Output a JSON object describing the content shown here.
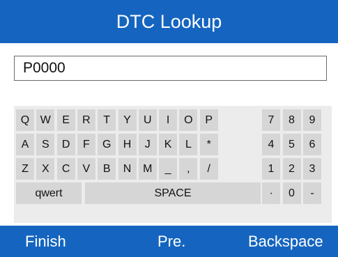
{
  "header": {
    "title": "DTC Lookup"
  },
  "input": {
    "value": "P0000"
  },
  "keyboard": {
    "letters": [
      [
        "Q",
        "W",
        "E",
        "R",
        "T",
        "Y",
        "U",
        "I",
        "O",
        "P"
      ],
      [
        "A",
        "S",
        "D",
        "F",
        "G",
        "H",
        "J",
        "K",
        "L",
        "*"
      ],
      [
        "Z",
        "X",
        "C",
        "V",
        "B",
        "N",
        "M",
        "_",
        ",",
        "/"
      ]
    ],
    "numbers": [
      [
        "7",
        "8",
        "9"
      ],
      [
        "4",
        "5",
        "6"
      ],
      [
        "1",
        "2",
        "3"
      ],
      [
        "·",
        "0",
        "-"
      ]
    ],
    "qwert_label": "qwert",
    "space_label": "SPACE"
  },
  "softkeys": {
    "left": "Finish",
    "middle": "Pre.",
    "right": "Backspace"
  },
  "colors": {
    "bar": "#1565c0",
    "key": "#d6d6d6",
    "keyboard_bg": "#ececec"
  }
}
